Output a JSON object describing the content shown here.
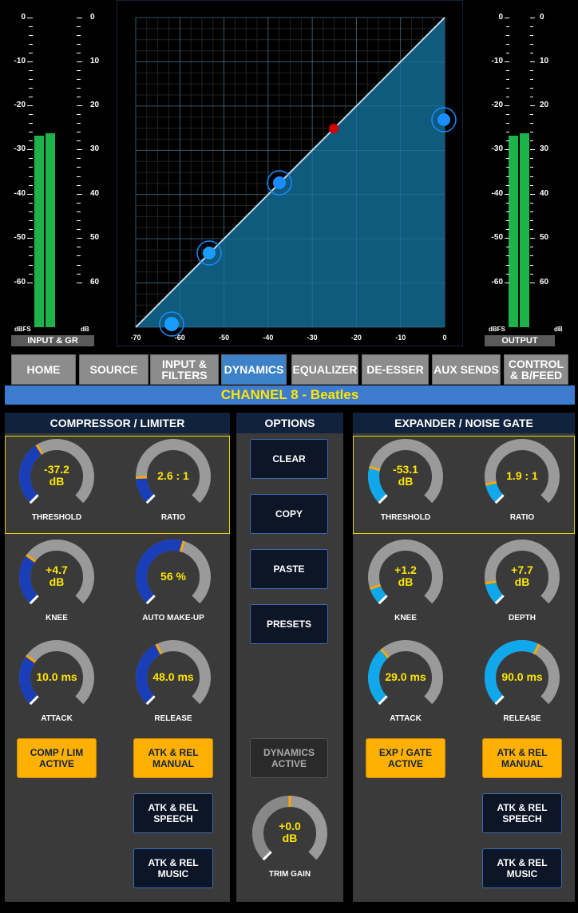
{
  "meters": {
    "scale_left": [
      "0",
      "-10",
      "-20",
      "-30",
      "-40",
      "-50",
      "-60"
    ],
    "scale_right": [
      "0",
      "10",
      "20",
      "30",
      "40",
      "50",
      "60"
    ],
    "input_label": "INPUT & GR",
    "output_label": "OUTPUT",
    "dbfs": "dBFS",
    "db": "dB",
    "input_levels": [
      -27,
      -26
    ],
    "output_levels": [
      -27,
      -26
    ]
  },
  "graph": {
    "x_ticks": [
      "-70",
      "-60",
      "-50",
      "-40",
      "-30",
      "-20",
      "-10",
      "0"
    ],
    "curve_color": "#bcd6e6",
    "fill_color": "#0f5a7d",
    "handle_color": "#1a8cff",
    "threshold_color": "#d40000"
  },
  "tabs": [
    {
      "label": "HOME",
      "active": false
    },
    {
      "label": "SOURCE",
      "active": false
    },
    {
      "label": "INPUT & FILTERS",
      "active": false
    },
    {
      "label": "DYNAMICS",
      "active": true
    },
    {
      "label": "EQUALIZER",
      "active": false
    },
    {
      "label": "DE-ESSER",
      "active": false
    },
    {
      "label": "AUX SENDS",
      "active": false
    },
    {
      "label": "CONTROL & B/FEED",
      "active": false
    }
  ],
  "channel": {
    "title": "CHANNEL 8  -  Beatles"
  },
  "compressor": {
    "title": "COMPRESSOR / LIMITER",
    "threshold": {
      "value": "-37.2",
      "unit": "dB",
      "label": "THRESHOLD",
      "fraction": 0.38
    },
    "ratio": {
      "value": "2.6 : 1",
      "label": "RATIO",
      "fraction": 0.16
    },
    "knee": {
      "value": "+4.7",
      "unit": "dB",
      "label": "KNEE",
      "fraction": 0.3
    },
    "makeup": {
      "value": "56 %",
      "label": "AUTO MAKE-UP",
      "fraction": 0.56
    },
    "attack": {
      "value": "10.0 ms",
      "label": "ATTACK",
      "fraction": 0.3
    },
    "release": {
      "value": "48.0 ms",
      "label": "RELEASE",
      "fraction": 0.4
    },
    "active_btn": "COMP / LIM ACTIVE",
    "manual_btn": "ATK & REL MANUAL",
    "speech_btn": "ATK & REL SPEECH",
    "music_btn": "ATK & REL MUSIC"
  },
  "options": {
    "title": "OPTIONS",
    "clear": "CLEAR",
    "copy": "COPY",
    "paste": "PASTE",
    "presets": "PRESETS",
    "dyn_active": "DYNAMICS ACTIVE",
    "trim": {
      "value": "+0.0",
      "unit": "dB",
      "label": "TRIM GAIN",
      "fraction": 0.5
    }
  },
  "expander": {
    "title": "EXPANDER / NOISE GATE",
    "threshold": {
      "value": "-53.1",
      "unit": "dB",
      "label": "THRESHOLD",
      "fraction": 0.22
    },
    "ratio": {
      "value": "1.9 : 1",
      "label": "RATIO",
      "fraction": 0.12
    },
    "knee": {
      "value": "+1.2",
      "unit": "dB",
      "label": "KNEE",
      "fraction": 0.1
    },
    "depth": {
      "value": "+7.7",
      "unit": "dB",
      "label": "DEPTH",
      "fraction": 0.13
    },
    "attack": {
      "value": "29.0 ms",
      "label": "ATTACK",
      "fraction": 0.35
    },
    "release": {
      "value": "90.0 ms",
      "label": "RELEASE",
      "fraction": 0.6
    },
    "active_btn": "EXP / GATE ACTIVE",
    "manual_btn": "ATK & REL MANUAL",
    "speech_btn": "ATK & REL SPEECH",
    "music_btn": "ATK & REL MUSIC"
  }
}
